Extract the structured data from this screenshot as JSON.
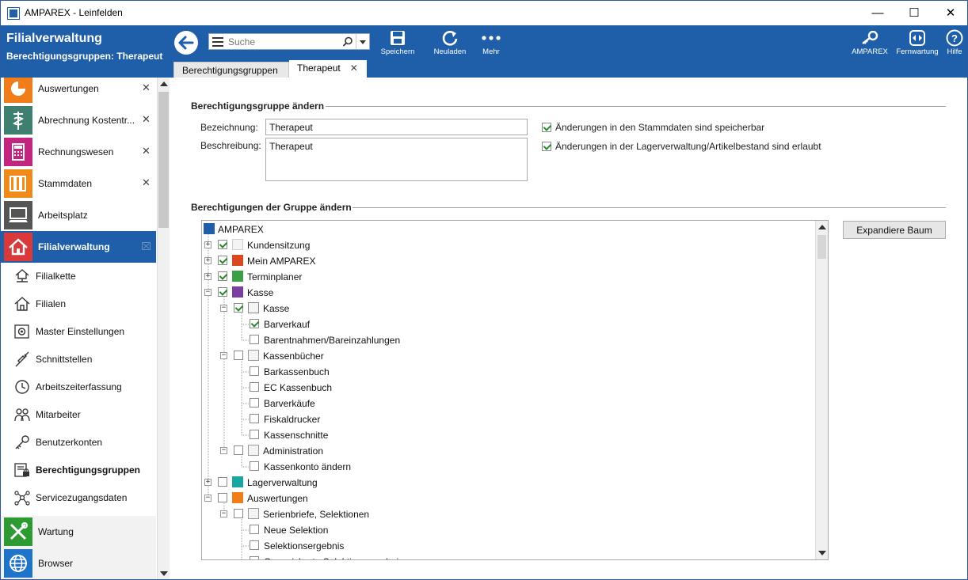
{
  "window": {
    "title": "AMPAREX - Leinfelden",
    "controls": {
      "minimize": "—",
      "maximize": "☐",
      "close": "✕"
    }
  },
  "header": {
    "title": "Filialverwaltung",
    "subtitle": "Berechtigungsgruppen: Therapeut",
    "search_placeholder": "Suche",
    "toolbar": [
      {
        "label": "Speichern",
        "icon": "save-icon"
      },
      {
        "label": "Neuladen",
        "icon": "reload-icon"
      },
      {
        "label": "Mehr",
        "icon": "more-icon"
      }
    ],
    "right_toolbar": [
      {
        "label": "AMPAREX",
        "icon": "key-icon"
      },
      {
        "label": "Fernwartung",
        "icon": "remote-icon"
      },
      {
        "label": "Hilfe",
        "icon": "help-icon"
      }
    ],
    "tabs": [
      {
        "label": "Berechtigungsgruppen",
        "active": false
      },
      {
        "label": "Therapeut",
        "active": true,
        "close": "✕"
      }
    ]
  },
  "sidebar": {
    "modules": [
      {
        "label": "Auswertungen",
        "color": "#f07d1a",
        "closable": true,
        "close": "✕",
        "icon": "pie-chart-icon"
      },
      {
        "label": "Abrechnung Kostentr...",
        "color": "#3f7f6f",
        "closable": true,
        "close": "✕",
        "icon": "caduceus-icon"
      },
      {
        "label": "Rechnungswesen",
        "color": "#c3257e",
        "closable": true,
        "close": "✕",
        "icon": "calculator-icon"
      },
      {
        "label": "Stammdaten",
        "color": "#f08a1a",
        "closable": true,
        "close": "✕",
        "icon": "binders-icon"
      },
      {
        "label": "Arbeitsplatz",
        "color": "#555555",
        "closable": false,
        "icon": "computer-icon"
      },
      {
        "label": "Filialverwaltung",
        "color": "#d9393b",
        "closable": false,
        "active": true,
        "icon": "home-icon"
      }
    ],
    "subitems": [
      {
        "label": "Filialkette",
        "icon": "branch-chain-icon"
      },
      {
        "label": "Filialen",
        "icon": "house-icon"
      },
      {
        "label": "Master Einstellungen",
        "icon": "settings-icon"
      },
      {
        "label": "Schnittstellen",
        "icon": "plug-icon"
      },
      {
        "label": "Arbeitszeiterfassung",
        "icon": "clock-icon"
      },
      {
        "label": "Mitarbeiter",
        "icon": "users-icon"
      },
      {
        "label": "Benutzerkonten",
        "icon": "key-icon"
      },
      {
        "label": "Berechtigungsgruppen",
        "icon": "lock-doc-icon",
        "selected": true
      },
      {
        "label": "Servicezugangsdaten",
        "icon": "network-icon"
      }
    ],
    "bottom_modules": [
      {
        "label": "Wartung",
        "color": "#2e9a32",
        "icon": "tools-icon"
      },
      {
        "label": "Browser",
        "color": "#1f73c8",
        "icon": "globe-icon"
      }
    ]
  },
  "main": {
    "group1_title": "Berechtigungsgruppe ändern",
    "bezeichnung_label": "Bezeichnung:",
    "bezeichnung_value": "Therapeut",
    "beschreibung_label": "Beschreibung:",
    "beschreibung_value": "Therapeut",
    "check1_label": "Änderungen in den Stammdaten sind speicherbar",
    "check1_checked": true,
    "check2_label": "Änderungen in der Lagerverwaltung/Artikelbestand sind erlaubt",
    "check2_checked": true,
    "group2_title": "Berechtigungen der Gruppe ändern",
    "expand_button": "Expandiere Baum",
    "tree": [
      {
        "label": "AMPAREX",
        "level": 0,
        "expander": "none",
        "checkbox": false,
        "icon": "amparex-icon"
      },
      {
        "label": "Kundensitzung",
        "level": 1,
        "expander": "+",
        "checked": true,
        "icon": "kunden-icon"
      },
      {
        "label": "Mein AMPAREX",
        "level": 1,
        "expander": "+",
        "checked": true,
        "icon": "mein-amparex-icon"
      },
      {
        "label": "Terminplaner",
        "level": 1,
        "expander": "+",
        "checked": true,
        "icon": "calendar-icon"
      },
      {
        "label": "Kasse",
        "level": 1,
        "expander": "-",
        "checked": true,
        "icon": "register-icon"
      },
      {
        "label": "Kasse",
        "level": 2,
        "expander": "-",
        "checked": true,
        "icon": "basket-icon"
      },
      {
        "label": "Barverkauf",
        "level": 3,
        "expander": "none",
        "checked": true
      },
      {
        "label": "Barentnahmen/Bareinzahlungen",
        "level": 3,
        "expander": "none",
        "checked": false
      },
      {
        "label": "Kassenbücher",
        "level": 2,
        "expander": "-",
        "checked": false,
        "icon": "books-icon"
      },
      {
        "label": "Barkassenbuch",
        "level": 3,
        "expander": "none",
        "checked": false
      },
      {
        "label": "EC Kassenbuch",
        "level": 3,
        "expander": "none",
        "checked": false
      },
      {
        "label": "Barverkäufe",
        "level": 3,
        "expander": "none",
        "checked": false
      },
      {
        "label": "Fiskaldrucker",
        "level": 3,
        "expander": "none",
        "checked": false
      },
      {
        "label": "Kassenschnitte",
        "level": 3,
        "expander": "none",
        "checked": false
      },
      {
        "label": "Administration",
        "level": 2,
        "expander": "-",
        "checked": false,
        "icon": "gear-icon"
      },
      {
        "label": "Kassenkonto ändern",
        "level": 3,
        "expander": "none",
        "checked": false
      },
      {
        "label": "Lagerverwaltung",
        "level": 1,
        "expander": "+",
        "checked": false,
        "icon": "stock-icon"
      },
      {
        "label": "Auswertungen",
        "level": 1,
        "expander": "-",
        "checked": false,
        "icon": "pie-chart-icon"
      },
      {
        "label": "Serienbriefe, Selektionen",
        "level": 2,
        "expander": "-",
        "checked": false,
        "icon": "selection-icon"
      },
      {
        "label": "Neue Selektion",
        "level": 3,
        "expander": "none",
        "checked": false
      },
      {
        "label": "Selektionsergebnis",
        "level": 3,
        "expander": "none",
        "checked": false
      },
      {
        "label": "Gespeicherte Selektionsergebnisse",
        "level": 3,
        "expander": "none",
        "checked": false
      }
    ]
  },
  "colors": {
    "brand_blue": "#1f5ea8",
    "check_green": "#2a8a2a"
  }
}
